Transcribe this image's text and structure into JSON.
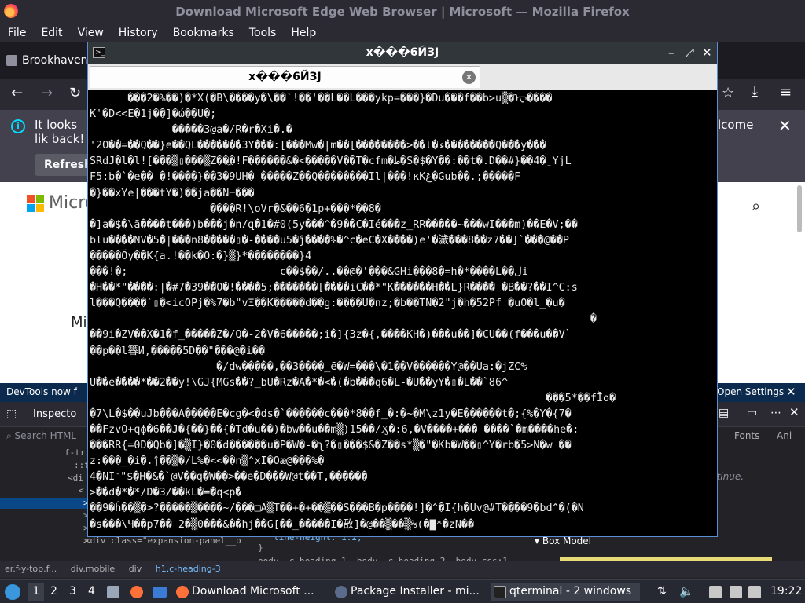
{
  "browser": {
    "window_title": "Download Microsoft Edge Web Browser | Microsoft — Mozilla Firefox",
    "menu": [
      "File",
      "Edit",
      "View",
      "History",
      "Bookmarks",
      "Tools",
      "Help"
    ],
    "tab_label": "Brookhaven",
    "notification": {
      "text_left": "It looks lik back!",
      "text_right": "lcome",
      "refresh_label": "Refresh"
    },
    "page": {
      "brand_partial": "Micro",
      "body_partial": "Mi"
    }
  },
  "devtools": {
    "banner": "DevTools now f",
    "banner_right": "Open Settings",
    "inspector_label": "Inspecto",
    "search_placeholder": "Search HTML",
    "html_tree": [
      "f-tr",
      "::t",
      "<di",
      "<",
      ">",
      ">",
      ">",
      ">",
      "<div class=\"expansion-panel__p"
    ],
    "css_lines": [
      "line-height: 1.2;",
      "}",
      "body .c-heading-1, body .c-heading-2, body   css:1"
    ],
    "right_tabs": [
      "Fonts",
      "Ani"
    ],
    "continue_text": "ntinue.",
    "box_model_label": "Box Model",
    "breadcrumb": [
      "er.f-y-top.f...",
      "div.mobile",
      "div",
      "h1.c-heading-3"
    ]
  },
  "terminal": {
    "title": "x���6ЙЗJ",
    "tab_title": "x���6ЙЗJ",
    "lines": [
      "      ���2�%��)�*X(�B\\����y�\\��`!��'��L��L���ykp=���}�Du���f��b>u▒�ᠧ����",
      "K'�D<<E�1j��]�ώ��Ū�;",
      "             �����3@a�/R�r�Xi�.�",
      "'2O��=��Q��}e��QL�������3Y���:[���Mw�|m��[��������>��l�ء��������Q���y���",
      "SRdJ�l�l![���▒▯���▒Z��ֱ�!F������&�<�����V��T�cfm�ط�S�$�Y��:��t�.D��#}��4�ˍYjL",
      "F5:b�`�e�� �!����}��3�9UH� �����Z��Q��������Il|���!ĸKڠ�Gub��.;�����F",
      "�}��xYe|���tY�)��ja��N⌐���",
      "                   ����R!\\oVr�&��6�1p+���*��8�",
      "�]a�$�\\ã����t���)b���j�n/զ�1�#0(5y���^�9��C�Ié���z_RR�����~���wI���m)��E�V;��",
      "blū����NV�5�|���n8�����▯�-����u5�ĵ����%�^c�eC�X����)e'�濊���8��z7��]`���@��P",
      "�����Ŏy��K{a.!��k�O:�}▒}*��������}4",
      "���!�;                        c��$��/..��@�'���&GHi���8�=h�*����L��ڶi",
      "�H��*\"����:|�#7�39��O�!����5;�������[����iC��*\"K������H��L}R���� �B��?��I^C:s",
      "l���Q����`▯�<icOPj�%7�b\"vΞ��K�����d��g:����U�nz;�b��TN�2\"j�h�52Pf �uO�l_�u�",
      "                                                                               �",
      "��9i�ZV��X�1�f_�����Z�/Q�-2�V�6�����;i�]{3z�{,����KH�)���u��]�CU��(f���u��V`",
      "��p��l簭И,�����5D��\"���@�i��",
      "                    �/dw�����,��3����_ē�W=���\\�1��V������Y@��Ua:�jZC%",
      "U��e����*��2��y!\\GJ{MGs��?_bU�Rz�A�*�<�(�b���q6�L-�U��yY�▯�L��`86^",
      "                                                                        ���5*��fĬo�",
      "�7\\L�$��uJb���A�����E�cg�<�ds�`������c���*8��f_�:�~�M\\z1y�E������t�;{%�Y�{7�",
      "��FzvO+qф�6��J�{��}��{�Td�u��)�bw��u��m▒)15��/Ӽ�:6,�V����+��� ����`�m����he�:",
      "���RR{=0D�Qb�]�▒I}�0�d������u�P�W�-�ʅ?�▯���$&�Z��s*▒�\"�Kb�W��▯^Y�rb�5>N�w ��",
      "z:���_�i�.ĵ��▒�/L%�<<��n▒^xI�Oæ@���%�",
      "4�NI﮸\"$�H�&�`@V��q�W��>��e�D���W@t��T,������",
      ">��d�*�*/D�3/��kL�=�q<p�",
      "��9�ĥ��▒�>?�����▒����~/���□A▒T��+�+��▒��S���B�p����!]�^�I{h�Uv@#T����9�bd^�(�N",
      "�s���\\Ч��p7�� 2�▒0���&��hj��G[��_�����I�敔]�@��▒��▒%(�▇*�zN��"
    ]
  },
  "taskbar": {
    "workspaces": [
      "1",
      "2",
      "3",
      "4"
    ],
    "tasks": [
      "Download Microsoft ...",
      "Package Installer - mi...",
      "qterminal - 2 windows"
    ],
    "clock": "19:22"
  }
}
